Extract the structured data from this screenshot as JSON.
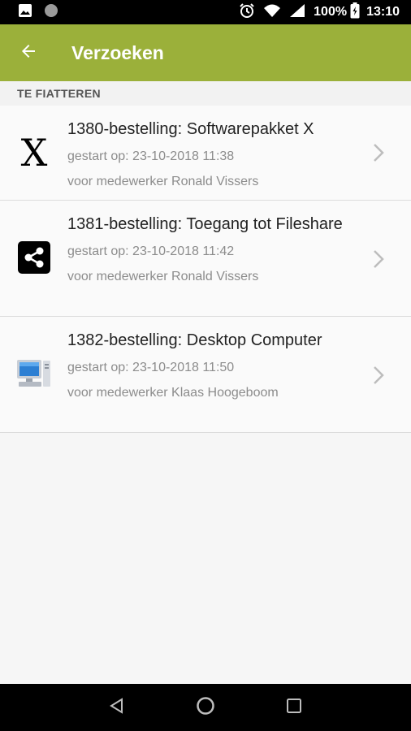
{
  "status_bar": {
    "battery": "100%",
    "time": "13:10"
  },
  "app_bar": {
    "title": "Verzoeken",
    "color": "#9bb03a"
  },
  "section": {
    "header": "TE FIATTEREN"
  },
  "requests": [
    {
      "title": "1380-bestelling: Softwarepakket X",
      "started": "gestart op: 23-10-2018 11:38",
      "employee": "voor medewerker Ronald Vissers",
      "icon": "x-letter-icon"
    },
    {
      "title": "1381-bestelling: Toegang tot Fileshare",
      "started": "gestart op: 23-10-2018 11:42",
      "employee": "voor medewerker Ronald Vissers",
      "icon": "share-icon"
    },
    {
      "title": "1382-bestelling: Desktop Computer",
      "started": "gestart op: 23-10-2018 11:50",
      "employee": "voor medewerker Klaas Hoogeboom",
      "icon": "desktop-computer-icon"
    }
  ],
  "icons": {
    "x_letter": "X"
  }
}
